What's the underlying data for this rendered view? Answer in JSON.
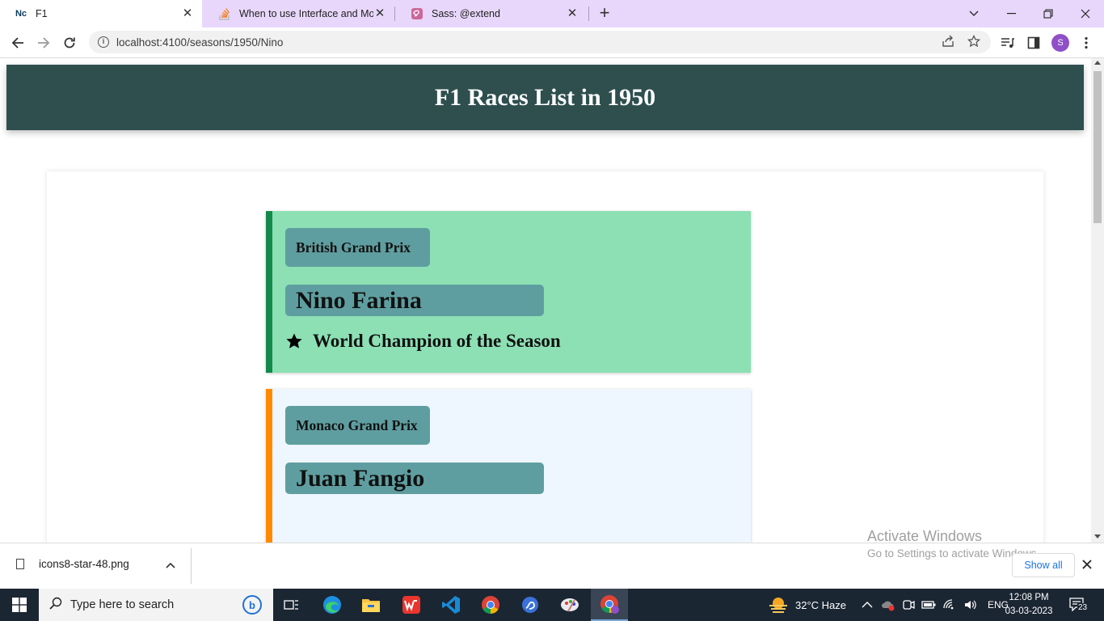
{
  "browser": {
    "tabs": [
      {
        "title": "F1",
        "favicon": "Nc",
        "active": true
      },
      {
        "title": "When to use Interface and Mode",
        "favicon": "stackoverflow-icon",
        "active": false
      },
      {
        "title": "Sass: @extend",
        "favicon": "sass-icon",
        "active": false
      }
    ],
    "url": "localhost:4100/seasons/1950/Nino",
    "profile_initial": "S"
  },
  "page": {
    "header_title": "F1 Races List in 1950",
    "colors": {
      "header_bg": "#2f4f4f",
      "label_bg": "#5f9ea0",
      "winner_card_bg": "#8ce0b4",
      "winner_bar": "#138a4a",
      "normal_card_bg": "#eef6ff",
      "normal_bar": "#ff8a00"
    },
    "races": [
      {
        "race_name": "British Grand Prix",
        "driver": "Nino Farina",
        "is_champion": true,
        "champion_text": "World Champion of the Season"
      },
      {
        "race_name": "Monaco Grand Prix",
        "driver": "Juan Fangio",
        "is_champion": false,
        "champion_text": ""
      }
    ]
  },
  "downloads": {
    "file_name": "icons8-star-48.png",
    "show_all": "Show all",
    "watermark_title": "Activate Windows",
    "watermark_sub": "Go to Settings to activate Windows."
  },
  "taskbar": {
    "search_placeholder": "Type here to search",
    "weather": "32°C  Haze",
    "language": "ENG",
    "time": "12:08 PM",
    "date": "03-03-2023",
    "notification_count": "23"
  }
}
